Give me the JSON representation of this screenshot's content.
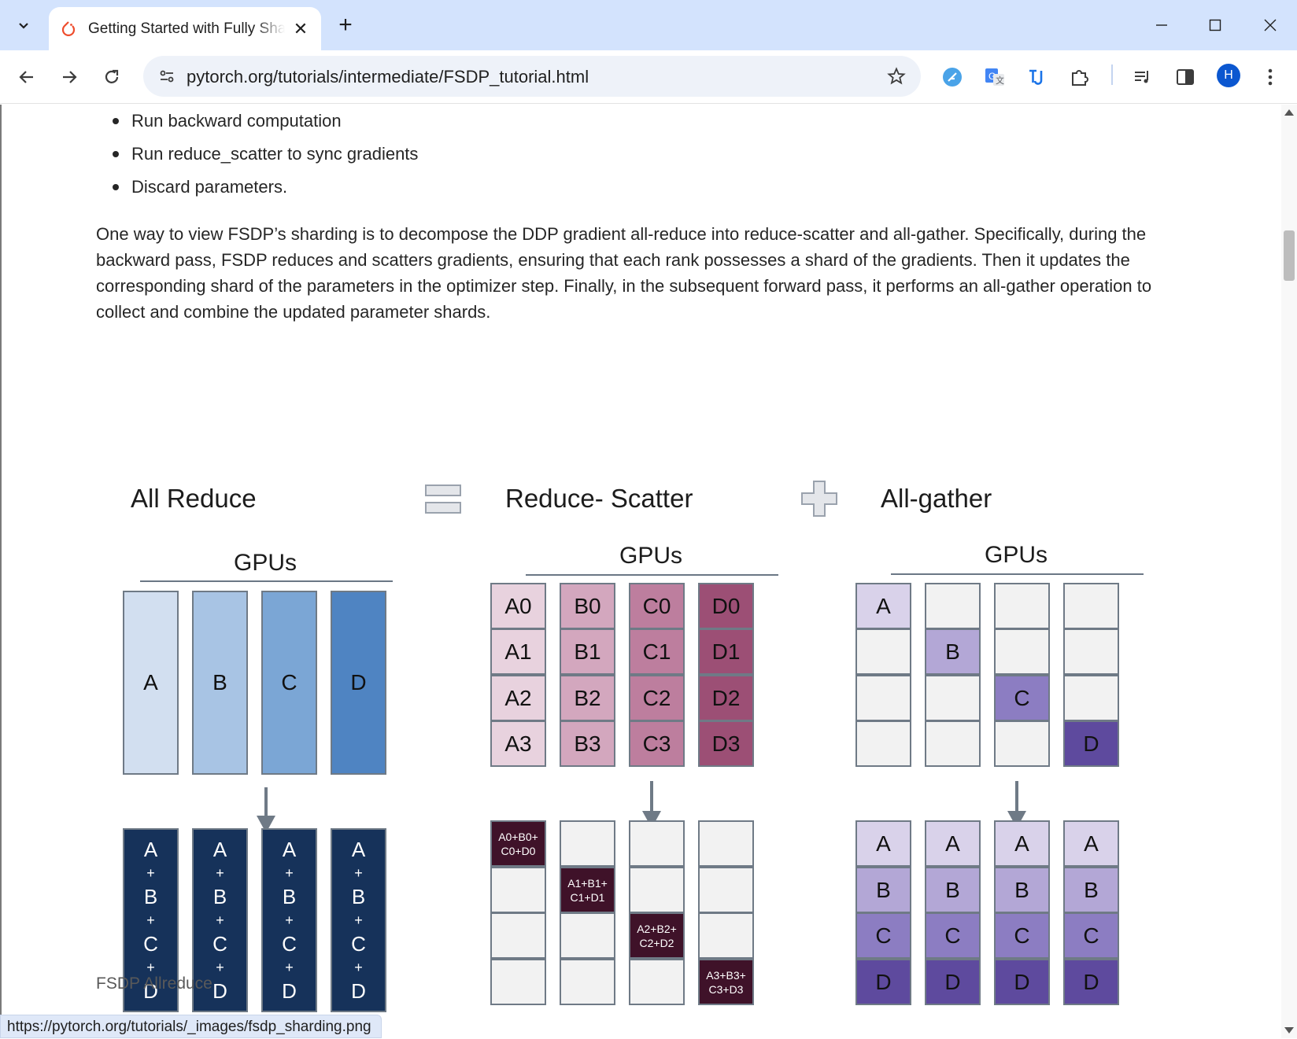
{
  "browser": {
    "tab_title": "Getting Started with Fully Sharded Data Parallel(FSDP)",
    "url": "pytorch.org/tutorials/intermediate/FSDP_tutorial.html",
    "avatar_letter": "H",
    "status_url": "https://pytorch.org/tutorials/_images/fsdp_sharding.png"
  },
  "content": {
    "bullets": [
      "Run backward computation",
      "Run reduce_scatter to sync gradients",
      "Discard parameters."
    ],
    "paragraph": "One way to view FSDP’s sharding is to decompose the DDP gradient all-reduce into reduce-scatter and all-gather. Specifically, during the backward pass, FSDP reduces and scatters gradients, ensuring that each rank possesses a shard of the gradients. Then it updates the corresponding shard of the parameters in the optimizer step. Finally, in the subsequent forward pass, it performs an all-gather operation to collect and combine the updated parameter shards.",
    "caption": "FSDP Allreduce"
  },
  "figure": {
    "titles": {
      "all_reduce": "All Reduce",
      "reduce_scatter": "Reduce- Scatter",
      "all_gather": "All-gather"
    },
    "gpus_label": "GPUs",
    "all_reduce": {
      "inputs": [
        "A",
        "B",
        "C",
        "D"
      ],
      "input_colors": [
        "#d2dff0",
        "#a8c4e4",
        "#7ba6d5",
        "#4f84c2"
      ],
      "output_glyphs": [
        "A",
        "+",
        "B",
        "+",
        "C",
        "+",
        "D"
      ],
      "output_color": "#16325a"
    },
    "reduce_scatter": {
      "inputs": [
        [
          "A0",
          "A1",
          "A2",
          "A3"
        ],
        [
          "B0",
          "B1",
          "B2",
          "B3"
        ],
        [
          "C0",
          "C1",
          "C2",
          "C3"
        ],
        [
          "D0",
          "D1",
          "D2",
          "D3"
        ]
      ],
      "input_colors": [
        "#e8d2de",
        "#d3a7be",
        "#bd7e9e",
        "#9c4f75"
      ],
      "outputs": [
        [
          "A0+B0+",
          "C0+D0"
        ],
        [
          "A1+B1+",
          "C1+D1"
        ],
        [
          "A2+B2+",
          "C2+D2"
        ],
        [
          "A3+B3+",
          "C3+D3"
        ]
      ],
      "output_color": "#3f1229",
      "empty_color": "#f2f2f2"
    },
    "all_gather": {
      "labels": [
        "A",
        "B",
        "C",
        "D"
      ],
      "colors": [
        "#d9d2ea",
        "#b3a7d6",
        "#8c7dc2",
        "#5e4a9e"
      ],
      "empty_color": "#f2f2f2"
    }
  }
}
